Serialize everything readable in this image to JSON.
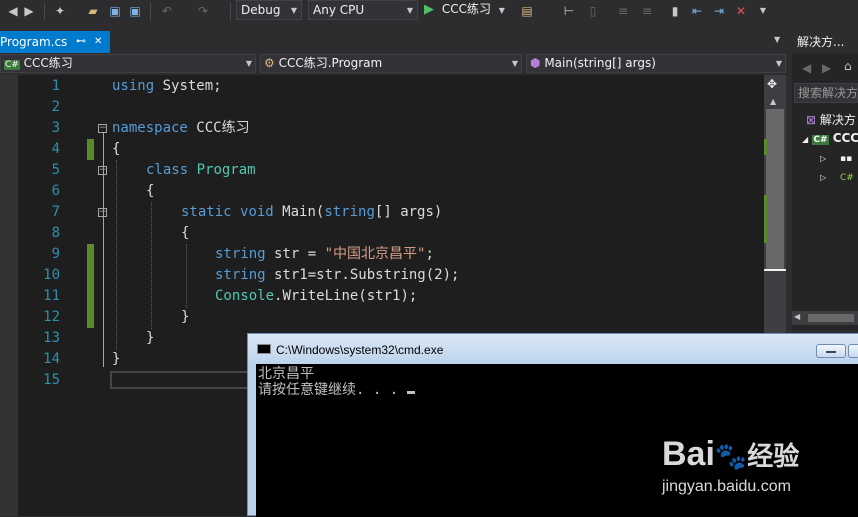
{
  "toolbar": {
    "configuration": "Debug",
    "platform": "Any CPU",
    "start_label": "CCC练习"
  },
  "editor_tab": {
    "filename": "Program.cs",
    "pin_glyph": "⊷",
    "close_glyph": "✕"
  },
  "navigation": {
    "project": "CCC练习",
    "class": "CCC练习.Program",
    "member": "Main(string[] args)"
  },
  "code": {
    "line_numbers": [
      "1",
      "2",
      "3",
      "4",
      "5",
      "6",
      "7",
      "8",
      "9",
      "10",
      "11",
      "12",
      "13",
      "14",
      "15"
    ],
    "line1_kw": "using",
    "line1_rest": " System;",
    "line3_kw": "namespace",
    "line3_rest": " CCC练习",
    "line4": "{",
    "line5_kw": "class",
    "line5_type": "Program",
    "line6": "{",
    "line7_kw1": "static",
    "line7_kw2": "void",
    "line7_name": "Main(",
    "line7_kw3": "string",
    "line7_rest": "[] args)",
    "line8": "{",
    "line9_kw": "string",
    "line9_mid": " str = ",
    "line9_str": "\"中国北京昌平\"",
    "line9_end": ";",
    "line10_kw": "string",
    "line10_rest": " str1=str.Substring(2);",
    "line11_type": "Console",
    "line11_rest": ".WriteLine(str1);",
    "line12": "}",
    "line13": "}",
    "line14": "}"
  },
  "solution_explorer": {
    "title": "解决方...",
    "search_placeholder": "搜索解决方",
    "root_item": "解决方",
    "project_item": "CCC"
  },
  "console_window": {
    "title": "C:\\Windows\\system32\\cmd.exe",
    "output_line1": "北京昌平",
    "output_line2": "请按任意键继续. . . "
  },
  "watermark": {
    "brand": "Bai",
    "brand_suffix": "经验",
    "url": "jingyan.baidu.com"
  }
}
